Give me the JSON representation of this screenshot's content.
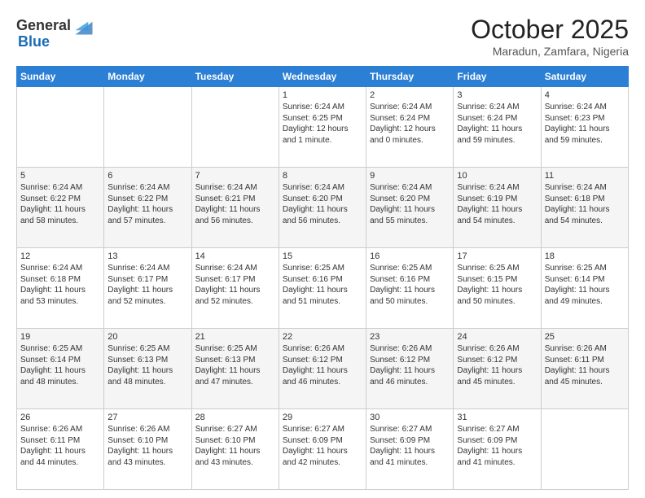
{
  "header": {
    "logo_general": "General",
    "logo_blue": "Blue",
    "month": "October 2025",
    "location": "Maradun, Zamfara, Nigeria"
  },
  "days_of_week": [
    "Sunday",
    "Monday",
    "Tuesday",
    "Wednesday",
    "Thursday",
    "Friday",
    "Saturday"
  ],
  "weeks": [
    [
      {
        "day": "",
        "info": ""
      },
      {
        "day": "",
        "info": ""
      },
      {
        "day": "",
        "info": ""
      },
      {
        "day": "1",
        "info": "Sunrise: 6:24 AM\nSunset: 6:25 PM\nDaylight: 12 hours\nand 1 minute."
      },
      {
        "day": "2",
        "info": "Sunrise: 6:24 AM\nSunset: 6:24 PM\nDaylight: 12 hours\nand 0 minutes."
      },
      {
        "day": "3",
        "info": "Sunrise: 6:24 AM\nSunset: 6:24 PM\nDaylight: 11 hours\nand 59 minutes."
      },
      {
        "day": "4",
        "info": "Sunrise: 6:24 AM\nSunset: 6:23 PM\nDaylight: 11 hours\nand 59 minutes."
      }
    ],
    [
      {
        "day": "5",
        "info": "Sunrise: 6:24 AM\nSunset: 6:22 PM\nDaylight: 11 hours\nand 58 minutes."
      },
      {
        "day": "6",
        "info": "Sunrise: 6:24 AM\nSunset: 6:22 PM\nDaylight: 11 hours\nand 57 minutes."
      },
      {
        "day": "7",
        "info": "Sunrise: 6:24 AM\nSunset: 6:21 PM\nDaylight: 11 hours\nand 56 minutes."
      },
      {
        "day": "8",
        "info": "Sunrise: 6:24 AM\nSunset: 6:20 PM\nDaylight: 11 hours\nand 56 minutes."
      },
      {
        "day": "9",
        "info": "Sunrise: 6:24 AM\nSunset: 6:20 PM\nDaylight: 11 hours\nand 55 minutes."
      },
      {
        "day": "10",
        "info": "Sunrise: 6:24 AM\nSunset: 6:19 PM\nDaylight: 11 hours\nand 54 minutes."
      },
      {
        "day": "11",
        "info": "Sunrise: 6:24 AM\nSunset: 6:18 PM\nDaylight: 11 hours\nand 54 minutes."
      }
    ],
    [
      {
        "day": "12",
        "info": "Sunrise: 6:24 AM\nSunset: 6:18 PM\nDaylight: 11 hours\nand 53 minutes."
      },
      {
        "day": "13",
        "info": "Sunrise: 6:24 AM\nSunset: 6:17 PM\nDaylight: 11 hours\nand 52 minutes."
      },
      {
        "day": "14",
        "info": "Sunrise: 6:24 AM\nSunset: 6:17 PM\nDaylight: 11 hours\nand 52 minutes."
      },
      {
        "day": "15",
        "info": "Sunrise: 6:25 AM\nSunset: 6:16 PM\nDaylight: 11 hours\nand 51 minutes."
      },
      {
        "day": "16",
        "info": "Sunrise: 6:25 AM\nSunset: 6:16 PM\nDaylight: 11 hours\nand 50 minutes."
      },
      {
        "day": "17",
        "info": "Sunrise: 6:25 AM\nSunset: 6:15 PM\nDaylight: 11 hours\nand 50 minutes."
      },
      {
        "day": "18",
        "info": "Sunrise: 6:25 AM\nSunset: 6:14 PM\nDaylight: 11 hours\nand 49 minutes."
      }
    ],
    [
      {
        "day": "19",
        "info": "Sunrise: 6:25 AM\nSunset: 6:14 PM\nDaylight: 11 hours\nand 48 minutes."
      },
      {
        "day": "20",
        "info": "Sunrise: 6:25 AM\nSunset: 6:13 PM\nDaylight: 11 hours\nand 48 minutes."
      },
      {
        "day": "21",
        "info": "Sunrise: 6:25 AM\nSunset: 6:13 PM\nDaylight: 11 hours\nand 47 minutes."
      },
      {
        "day": "22",
        "info": "Sunrise: 6:26 AM\nSunset: 6:12 PM\nDaylight: 11 hours\nand 46 minutes."
      },
      {
        "day": "23",
        "info": "Sunrise: 6:26 AM\nSunset: 6:12 PM\nDaylight: 11 hours\nand 46 minutes."
      },
      {
        "day": "24",
        "info": "Sunrise: 6:26 AM\nSunset: 6:12 PM\nDaylight: 11 hours\nand 45 minutes."
      },
      {
        "day": "25",
        "info": "Sunrise: 6:26 AM\nSunset: 6:11 PM\nDaylight: 11 hours\nand 45 minutes."
      }
    ],
    [
      {
        "day": "26",
        "info": "Sunrise: 6:26 AM\nSunset: 6:11 PM\nDaylight: 11 hours\nand 44 minutes."
      },
      {
        "day": "27",
        "info": "Sunrise: 6:26 AM\nSunset: 6:10 PM\nDaylight: 11 hours\nand 43 minutes."
      },
      {
        "day": "28",
        "info": "Sunrise: 6:27 AM\nSunset: 6:10 PM\nDaylight: 11 hours\nand 43 minutes."
      },
      {
        "day": "29",
        "info": "Sunrise: 6:27 AM\nSunset: 6:09 PM\nDaylight: 11 hours\nand 42 minutes."
      },
      {
        "day": "30",
        "info": "Sunrise: 6:27 AM\nSunset: 6:09 PM\nDaylight: 11 hours\nand 41 minutes."
      },
      {
        "day": "31",
        "info": "Sunrise: 6:27 AM\nSunset: 6:09 PM\nDaylight: 11 hours\nand 41 minutes."
      },
      {
        "day": "",
        "info": ""
      }
    ]
  ]
}
